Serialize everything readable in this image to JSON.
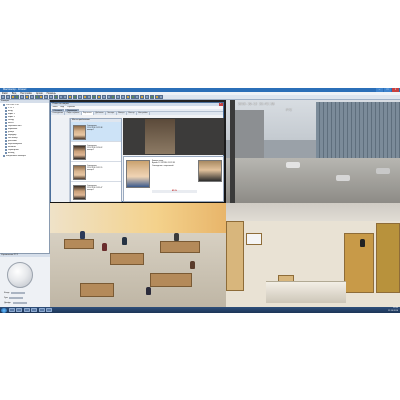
{
  "app": {
    "title": "Macroscop - Клиент",
    "window_buttons": [
      "–",
      "□",
      "×"
    ]
  },
  "menubar": [
    "Файл",
    "Вид",
    "Настройки",
    "Архив",
    "Помощь"
  ],
  "sidebar": {
    "header": "Камеры",
    "tree": [
      {
        "label": "192.168.1.10",
        "level": 1
      },
      {
        "label": "PTZ 1",
        "level": 2
      },
      {
        "label": "вход",
        "level": 2
      },
      {
        "label": "офис 1",
        "level": 2
      },
      {
        "label": "офис 2",
        "level": 2
      },
      {
        "label": "склад",
        "level": 2
      },
      {
        "label": "касса",
        "level": 2
      },
      {
        "label": "торговый зал",
        "level": 2
      },
      {
        "label": "парковка",
        "level": 2
      },
      {
        "label": "улица",
        "level": 2
      },
      {
        "label": "коридор",
        "level": 2
      },
      {
        "label": "лестница",
        "level": 2
      },
      {
        "label": "ресепшн",
        "level": 2
      },
      {
        "label": "переговорная",
        "level": 2
      },
      {
        "label": "кабинет",
        "level": 2
      },
      {
        "label": "серверная",
        "level": 2
      },
      {
        "label": "выход",
        "level": 2
      },
      {
        "label": "Избранные камеры",
        "level": 1
      }
    ],
    "ptz": {
      "header": "Управление PTZ",
      "rows": [
        "Фокус",
        "Зум",
        "Диафр."
      ]
    }
  },
  "face_window": {
    "title": "Поиск по лицам",
    "close": "×",
    "menu": [
      "Файл",
      "Вид",
      "Справка"
    ],
    "toolbar": [
      "Обновить",
      "Параметры"
    ],
    "tabs": [
      {
        "label": "Совпадения",
        "active": false
      },
      {
        "label": "Лица в архиве",
        "active": false
      },
      {
        "label": "Картотека",
        "active": true
      },
      {
        "label": "Добавить",
        "active": false
      },
      {
        "label": "Экспорт",
        "active": false
      },
      {
        "label": "Импорт",
        "active": false
      },
      {
        "label": "Фильтр",
        "active": false
      },
      {
        "label": "Настройки",
        "active": false
      }
    ],
    "list_header": "Места пребывания",
    "matches": [
      {
        "name": "Совпадение",
        "time": "12.10.2016 11:22:38",
        "cam": "камера 1",
        "face": "a"
      },
      {
        "name": "Совпадение",
        "time": "12.10.2016 11:24:02",
        "cam": "камера 2",
        "face": "b"
      },
      {
        "name": "Совпадение",
        "time": "12.10.2016 11:31:15",
        "cam": "камера 3",
        "face": "a"
      },
      {
        "name": "Совпадение",
        "time": "12.10.2016 11:35:47",
        "cam": "камера 1",
        "face": "b"
      }
    ],
    "detail": {
      "lines": [
        "Камера: вход",
        "Время: 12.10.2016 11:22:38",
        "Совпадение с картотекой"
      ],
      "score": "85 %"
    }
  },
  "cameras": [
    {
      "id": "cam1",
      "stamp": ""
    },
    {
      "id": "cam2",
      "stamp": "2016-10-12 23:45:38",
      "label": "PTZ"
    },
    {
      "id": "cam3",
      "stamp": ""
    },
    {
      "id": "cam4",
      "stamp": ""
    }
  ],
  "taskbar": {
    "tray_time": "23:45",
    "tray_date": "12.10.2016"
  },
  "colors": {
    "accent": "#2b6fb8",
    "taskbar": "#1c3557",
    "score": "#c02020"
  }
}
